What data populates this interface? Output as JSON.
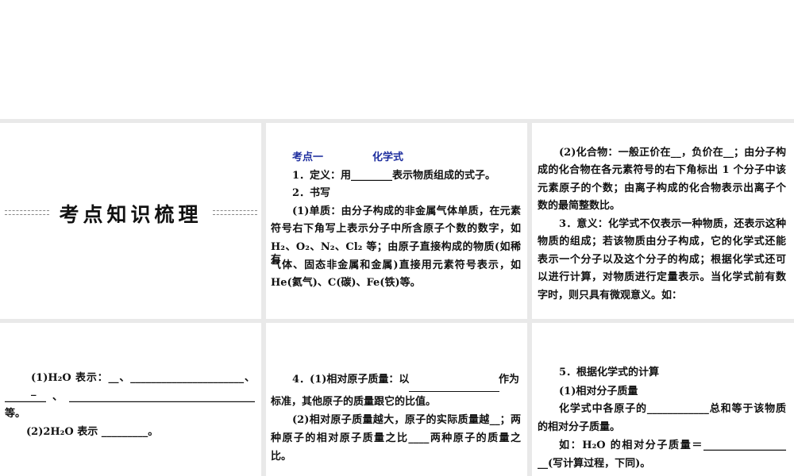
{
  "title_panel": {
    "heading": "考点知识梳理"
  },
  "panel_formula": {
    "section_label": "考点一",
    "section_title": "化学式",
    "lines": [
      "1．定义：用________表示物质组成的式子。",
      "2．书写",
      "(1)单质：由分子构成的非金属气体单质，在元素",
      "符号右下角写上表示分子中所含原子个数的数字，如",
      "H₂、O₂、N₂、Cl₂ 等；由原子直接构成的物质(如稀有",
      "气体、固态非金属和金属)直接用元素符号表示，如",
      "He(氦气)、C(碳)、Fe(铁)等。"
    ]
  },
  "panel_compound": {
    "lines": [
      "(2)化合物：一般正价在__，负价在__；由分子构",
      "成的化合物在各元素符号的右下角标出 1 个分子中该",
      "元素原子的个数；由离子构成的化合物表示出离子个",
      "数的最简整数比。",
      "3．意义：化学式不仅表示一种物质，还表示这种",
      "物质的组成；若该物质由分子构成，它的化学式还能",
      "表示一个分子以及这个分子的构成；根据化学式还可",
      "以进行计算，对物质进行定量表示。当化学式前有数",
      "字时，则只具有微观意义。如："
    ]
  },
  "panel_water": {
    "lines": [
      "(1)H₂O 表示：__、______________________、_",
      "________、____________________________________",
      "等。",
      "(2)2H₂O 表示 _________。"
    ]
  },
  "panel_atomic_mass": {
    "lines": [
      "4．(1)相对原子质量：以",
      "作为",
      "标准，其他原子的质量跟它的比值。",
      "(2)相对原子质量越大，原子的实际质量越__；两",
      "种原子的相对原子质量之比____两种原子的质量之",
      "比。"
    ]
  },
  "panel_calc": {
    "lines": [
      "5．根据化学式的计算",
      "(1)相对分子质量",
      "化学式中各原子的____________总和等于该物质",
      "的相对分子质量。",
      "如：H₂O  的相对分子质量＝________________",
      "__(写计算过程，下同)。"
    ]
  }
}
